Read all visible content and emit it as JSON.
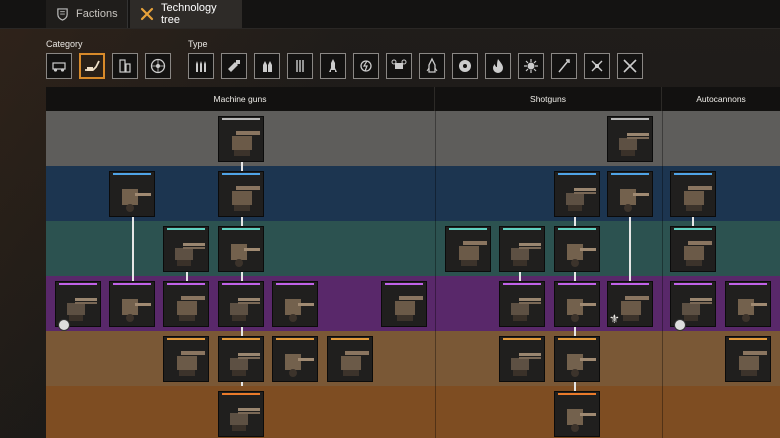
{
  "tabs": [
    {
      "label": "Factions",
      "icon": "shield-icon"
    },
    {
      "label": "Technology tree",
      "icon": "crossed-tools-icon",
      "active": true
    }
  ],
  "filters": {
    "category_label": "Category",
    "type_label": "Type",
    "categories": [
      {
        "icon": "vehicle-icon",
        "selected": false
      },
      {
        "icon": "turret-weapon-icon",
        "selected": true
      },
      {
        "icon": "equipment-icon",
        "selected": false
      },
      {
        "icon": "wheel-icon",
        "selected": false
      }
    ],
    "types": [
      {
        "icon": "ammo-icon"
      },
      {
        "icon": "shotgun-shell-icon"
      },
      {
        "icon": "cannon-shell-icon"
      },
      {
        "icon": "crossbow-icon"
      },
      {
        "icon": "rocket-icon"
      },
      {
        "icon": "energy-icon"
      },
      {
        "icon": "drone-icon"
      },
      {
        "icon": "missile-launcher-icon"
      },
      {
        "icon": "saw-blade-icon"
      },
      {
        "icon": "flame-icon"
      },
      {
        "icon": "mine-icon"
      },
      {
        "icon": "harpoon-icon"
      },
      {
        "icon": "drone-quad-icon"
      },
      {
        "icon": "crossed-melee-icon"
      }
    ]
  },
  "tree": {
    "columns": [
      {
        "label": "Machine guns"
      },
      {
        "label": "Shotguns"
      },
      {
        "label": "Autocannons"
      }
    ],
    "tier_colors": [
      "#5e5d5b",
      "#1c3550",
      "#2c5250",
      "#59286a",
      "#7a5836",
      "#7e4d22"
    ],
    "rarity_colors": {
      "common": "#b8b8b8",
      "rare": "#4fa3e6",
      "special": "#5fd0c0",
      "epic": "#c062e8",
      "legendary": "#e29a3a",
      "relic": "#ea7a2a"
    }
  }
}
